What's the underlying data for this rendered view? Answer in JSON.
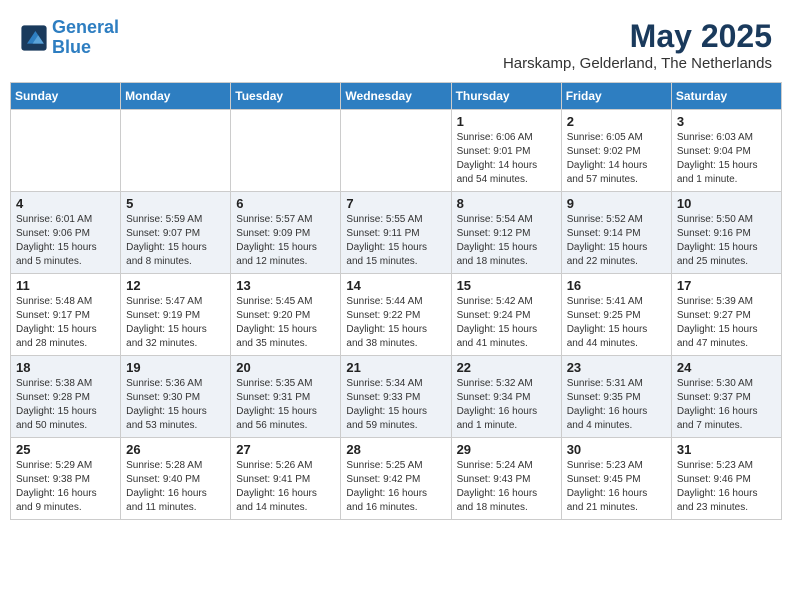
{
  "header": {
    "logo_line1": "General",
    "logo_line2": "Blue",
    "month_year": "May 2025",
    "location": "Harskamp, Gelderland, The Netherlands"
  },
  "days_of_week": [
    "Sunday",
    "Monday",
    "Tuesday",
    "Wednesday",
    "Thursday",
    "Friday",
    "Saturday"
  ],
  "weeks": [
    [
      {
        "day": "",
        "detail": ""
      },
      {
        "day": "",
        "detail": ""
      },
      {
        "day": "",
        "detail": ""
      },
      {
        "day": "",
        "detail": ""
      },
      {
        "day": "1",
        "detail": "Sunrise: 6:06 AM\nSunset: 9:01 PM\nDaylight: 14 hours\nand 54 minutes."
      },
      {
        "day": "2",
        "detail": "Sunrise: 6:05 AM\nSunset: 9:02 PM\nDaylight: 14 hours\nand 57 minutes."
      },
      {
        "day": "3",
        "detail": "Sunrise: 6:03 AM\nSunset: 9:04 PM\nDaylight: 15 hours\nand 1 minute."
      }
    ],
    [
      {
        "day": "4",
        "detail": "Sunrise: 6:01 AM\nSunset: 9:06 PM\nDaylight: 15 hours\nand 5 minutes."
      },
      {
        "day": "5",
        "detail": "Sunrise: 5:59 AM\nSunset: 9:07 PM\nDaylight: 15 hours\nand 8 minutes."
      },
      {
        "day": "6",
        "detail": "Sunrise: 5:57 AM\nSunset: 9:09 PM\nDaylight: 15 hours\nand 12 minutes."
      },
      {
        "day": "7",
        "detail": "Sunrise: 5:55 AM\nSunset: 9:11 PM\nDaylight: 15 hours\nand 15 minutes."
      },
      {
        "day": "8",
        "detail": "Sunrise: 5:54 AM\nSunset: 9:12 PM\nDaylight: 15 hours\nand 18 minutes."
      },
      {
        "day": "9",
        "detail": "Sunrise: 5:52 AM\nSunset: 9:14 PM\nDaylight: 15 hours\nand 22 minutes."
      },
      {
        "day": "10",
        "detail": "Sunrise: 5:50 AM\nSunset: 9:16 PM\nDaylight: 15 hours\nand 25 minutes."
      }
    ],
    [
      {
        "day": "11",
        "detail": "Sunrise: 5:48 AM\nSunset: 9:17 PM\nDaylight: 15 hours\nand 28 minutes."
      },
      {
        "day": "12",
        "detail": "Sunrise: 5:47 AM\nSunset: 9:19 PM\nDaylight: 15 hours\nand 32 minutes."
      },
      {
        "day": "13",
        "detail": "Sunrise: 5:45 AM\nSunset: 9:20 PM\nDaylight: 15 hours\nand 35 minutes."
      },
      {
        "day": "14",
        "detail": "Sunrise: 5:44 AM\nSunset: 9:22 PM\nDaylight: 15 hours\nand 38 minutes."
      },
      {
        "day": "15",
        "detail": "Sunrise: 5:42 AM\nSunset: 9:24 PM\nDaylight: 15 hours\nand 41 minutes."
      },
      {
        "day": "16",
        "detail": "Sunrise: 5:41 AM\nSunset: 9:25 PM\nDaylight: 15 hours\nand 44 minutes."
      },
      {
        "day": "17",
        "detail": "Sunrise: 5:39 AM\nSunset: 9:27 PM\nDaylight: 15 hours\nand 47 minutes."
      }
    ],
    [
      {
        "day": "18",
        "detail": "Sunrise: 5:38 AM\nSunset: 9:28 PM\nDaylight: 15 hours\nand 50 minutes."
      },
      {
        "day": "19",
        "detail": "Sunrise: 5:36 AM\nSunset: 9:30 PM\nDaylight: 15 hours\nand 53 minutes."
      },
      {
        "day": "20",
        "detail": "Sunrise: 5:35 AM\nSunset: 9:31 PM\nDaylight: 15 hours\nand 56 minutes."
      },
      {
        "day": "21",
        "detail": "Sunrise: 5:34 AM\nSunset: 9:33 PM\nDaylight: 15 hours\nand 59 minutes."
      },
      {
        "day": "22",
        "detail": "Sunrise: 5:32 AM\nSunset: 9:34 PM\nDaylight: 16 hours\nand 1 minute."
      },
      {
        "day": "23",
        "detail": "Sunrise: 5:31 AM\nSunset: 9:35 PM\nDaylight: 16 hours\nand 4 minutes."
      },
      {
        "day": "24",
        "detail": "Sunrise: 5:30 AM\nSunset: 9:37 PM\nDaylight: 16 hours\nand 7 minutes."
      }
    ],
    [
      {
        "day": "25",
        "detail": "Sunrise: 5:29 AM\nSunset: 9:38 PM\nDaylight: 16 hours\nand 9 minutes."
      },
      {
        "day": "26",
        "detail": "Sunrise: 5:28 AM\nSunset: 9:40 PM\nDaylight: 16 hours\nand 11 minutes."
      },
      {
        "day": "27",
        "detail": "Sunrise: 5:26 AM\nSunset: 9:41 PM\nDaylight: 16 hours\nand 14 minutes."
      },
      {
        "day": "28",
        "detail": "Sunrise: 5:25 AM\nSunset: 9:42 PM\nDaylight: 16 hours\nand 16 minutes."
      },
      {
        "day": "29",
        "detail": "Sunrise: 5:24 AM\nSunset: 9:43 PM\nDaylight: 16 hours\nand 18 minutes."
      },
      {
        "day": "30",
        "detail": "Sunrise: 5:23 AM\nSunset: 9:45 PM\nDaylight: 16 hours\nand 21 minutes."
      },
      {
        "day": "31",
        "detail": "Sunrise: 5:23 AM\nSunset: 9:46 PM\nDaylight: 16 hours\nand 23 minutes."
      }
    ]
  ]
}
